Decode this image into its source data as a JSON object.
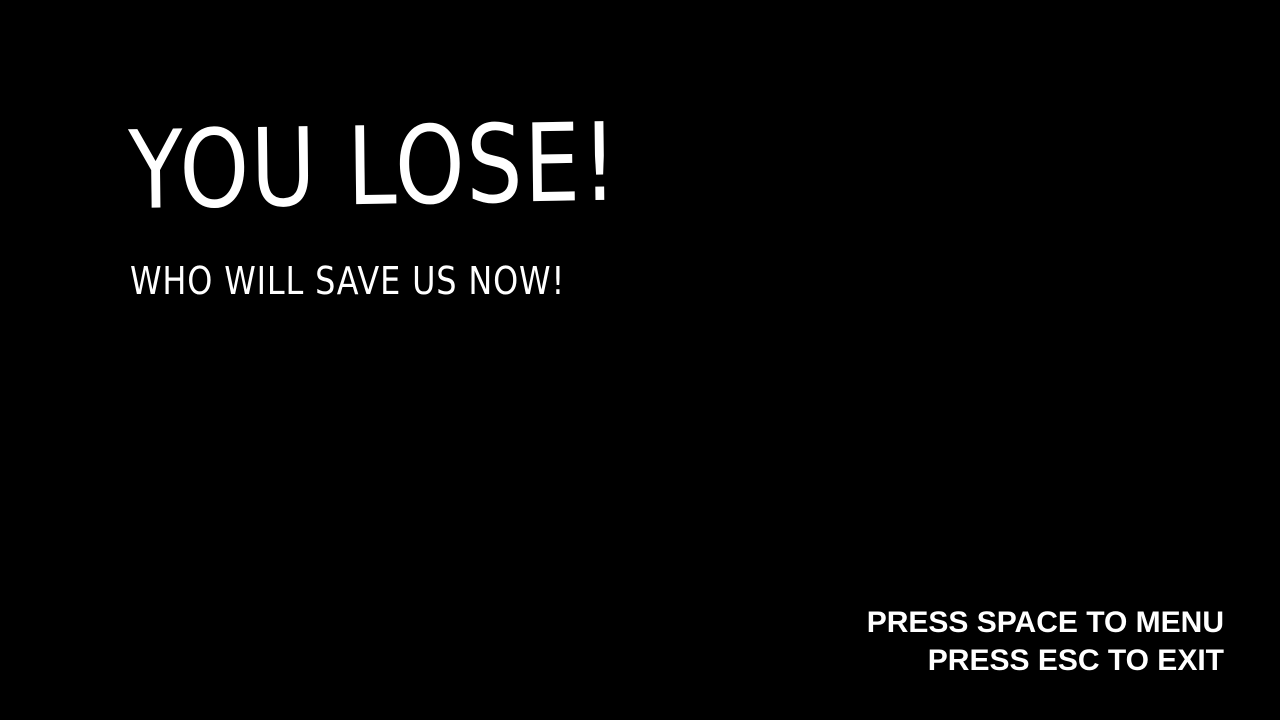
{
  "colors": {
    "background": "#000000",
    "text": "#ffffff"
  },
  "game_over": {
    "title": "YOU LOSE!",
    "subtitle": "WHO WILL SAVE US NOW!"
  },
  "controls": {
    "menu_prompt": "PRESS SPACE TO MENU",
    "exit_prompt": "PRESS ESC TO EXIT"
  }
}
